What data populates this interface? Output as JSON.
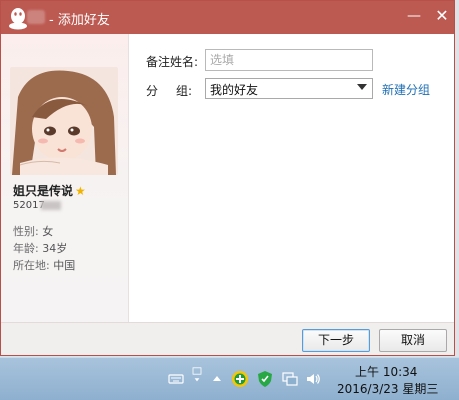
{
  "window": {
    "title": "- 添加好友"
  },
  "titlebar": {
    "min_glyph": "—",
    "close_glyph": "✕"
  },
  "profile": {
    "nickname": "姐只是传说",
    "qq_number_visible": "52017",
    "gender_label": "性别:",
    "gender": "女",
    "age_label": "年龄:",
    "age": "34岁",
    "location_label": "所在地:",
    "location": "中国"
  },
  "form": {
    "note_label": "备注姓名:",
    "note_placeholder": "选填",
    "group_label_1": "分",
    "group_label_2": "组:",
    "group_value": "我的好友",
    "new_group_link": "新建分组"
  },
  "buttons": {
    "next": "下一步",
    "cancel": "取消"
  },
  "taskbar": {
    "time": "上午 10:34",
    "date": "2016/3/23 星期三",
    "icons": [
      "keyboard-icon",
      "qq-tray-icon",
      "show-hidden-icons-icon",
      "360-safeguard-icon",
      "shield-icon",
      "network-icon",
      "volume-icon"
    ]
  }
}
